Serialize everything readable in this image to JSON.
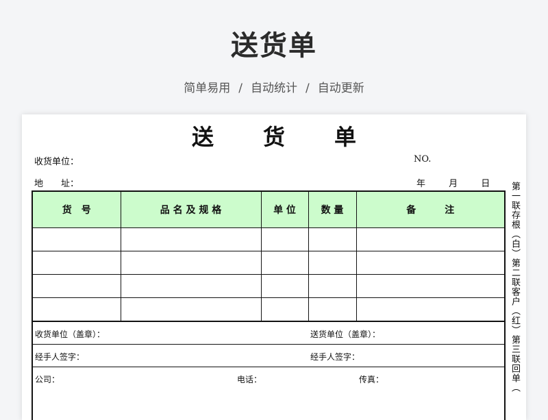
{
  "banner": {
    "title": "送货单",
    "subtitle_parts": [
      "简单易用",
      "自动统计",
      "自动更新"
    ],
    "separator": "/"
  },
  "form": {
    "title": "送货单",
    "receiver_label": "收货单位：",
    "no_label": "NO.",
    "address_label": "地　　址：",
    "date_label": "年 月 日",
    "columns": [
      "货　号",
      "品 名 及 规 格",
      "单 位",
      "数 量",
      "备　　　注"
    ],
    "rows": [
      [
        "",
        "",
        "",
        "",
        ""
      ],
      [
        "",
        "",
        "",
        "",
        ""
      ],
      [
        "",
        "",
        "",
        "",
        ""
      ],
      [
        "",
        "",
        "",
        "",
        ""
      ]
    ],
    "footer": {
      "receiver_seal": "收货单位（盖章）：",
      "sender_seal": "送货单位（盖章）：",
      "handler_left": "经手人签字：",
      "handler_right": "经手人签字：",
      "company": "公司：",
      "phone": "电话：",
      "fax": "传真："
    },
    "side_note": "第一联存根（白）第二联客户（红）第三联回单（"
  },
  "colors": {
    "header_fill": "#ccfccc",
    "page_bg": "#f4f5f7"
  }
}
